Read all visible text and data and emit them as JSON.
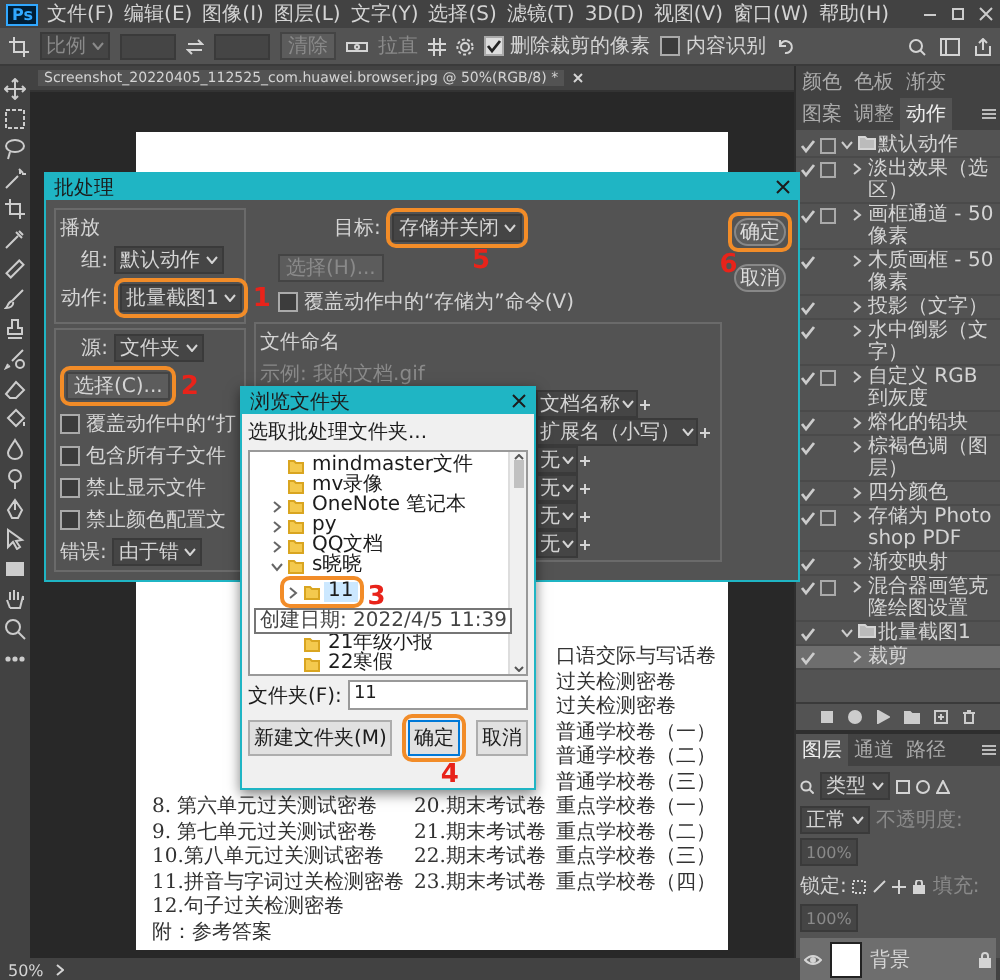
{
  "app_logo": "Ps",
  "menu_bar": {
    "items": [
      "文件(F)",
      "编辑(E)",
      "图像(I)",
      "图层(L)",
      "文字(Y)",
      "选择(S)",
      "滤镜(T)",
      "3D(D)",
      "视图(V)",
      "窗口(W)",
      "帮助(H)"
    ]
  },
  "options_bar": {
    "ratio": "比例",
    "clear": "清除",
    "straighten": "拉直",
    "checkboxes": [
      {
        "label": "删除裁剪的像素",
        "checked": true
      },
      {
        "label": "内容识别",
        "checked": false
      }
    ]
  },
  "document_tab": {
    "title": "Screenshot_20220405_112525_com.huawei.browser.jpg @ 50%(RGB/8) *"
  },
  "document": {
    "rows": [
      {
        "col_3": "口语交际与写话卷"
      },
      {
        "col_3": "过关检测密卷"
      },
      {
        "col_3": "过关检测密卷"
      },
      {
        "col_3": "普通学校卷（一）"
      },
      {
        "col_3": "普通学校卷（二）"
      },
      {
        "col_3": "普通学校卷（三）"
      },
      {
        "col_1": "8. 第六单元过关测试密卷",
        "col_2": "20.期末考试卷",
        "col_3": "重点学校卷（一）"
      },
      {
        "col_1": "9. 第七单元过关测试密卷",
        "col_2": "21.期末考试卷",
        "col_3": "重点学校卷（二）"
      },
      {
        "col_1": "10.第八单元过关测试密卷",
        "col_2": "22.期末考试卷",
        "col_3": "重点学校卷（三）"
      },
      {
        "col_1": "11.拼音与字词过关检测密卷",
        "col_2": "23.期末考试卷",
        "col_3": "重点学校卷（四）"
      },
      {
        "col_1": "12.句子过关检测密卷"
      }
    ],
    "appendix": "附：参考答案"
  },
  "batch_dialog": {
    "title": "批处理",
    "play": {
      "label": "播放",
      "set": {
        "label": "组:",
        "value": "默认动作"
      },
      "action": {
        "label": "动作:",
        "value": "批量截图1",
        "highlighted": true,
        "step": "1"
      }
    },
    "source": {
      "label": "源:",
      "value": "文件夹"
    },
    "choose": {
      "label": "选择(C)...",
      "highlighted": true,
      "step": "2"
    },
    "options": [
      {
        "label": "覆盖动作中的“打",
        "checked": false
      },
      {
        "label": "包含所有子文件",
        "checked": false
      },
      {
        "label": "禁止显示文件",
        "checked": false
      },
      {
        "label": "禁止颜色配置文",
        "checked": false
      }
    ],
    "errors": {
      "label": "错误:",
      "value": "由于错"
    },
    "destination": {
      "label": "目标:",
      "value": "存储并关闭",
      "highlighted": true,
      "step": "5"
    },
    "choose_destination": {
      "label": "选择(H)...",
      "disabled": true
    },
    "override_save": {
      "label": "覆盖动作中的“存储为”命令(V)",
      "checked": false
    },
    "file_naming": {
      "label": "文件命名",
      "example": "示例: 我的文档.gif",
      "fields": [
        "文档名称",
        "扩展名（小写）",
        "无",
        "无",
        "无",
        "无"
      ]
    },
    "buttons": [
      {
        "label": "确定",
        "highlighted": true,
        "step": "6"
      },
      {
        "label": "取消",
        "highlighted": false
      }
    ]
  },
  "browse_dialog": {
    "title": "浏览文件夹",
    "prompt": "选取批处理文件夹...",
    "tree": [
      {
        "label": "mindmaster文件",
        "kind": "leaf",
        "selected": false
      },
      {
        "label": "mv录像",
        "kind": "leaf",
        "selected": false
      },
      {
        "label": "OneNote 笔记本",
        "kind": "branch",
        "expanded": false,
        "selected": false
      },
      {
        "label": "py",
        "kind": "branch",
        "expanded": false,
        "selected": false
      },
      {
        "label": "QQ文档",
        "kind": "branch",
        "expanded": false,
        "selected": false
      },
      {
        "label": "s晓晓",
        "kind": "branch",
        "expanded": true,
        "selected": false,
        "children": [
          {
            "label": "11",
            "kind": "branch",
            "expanded": false,
            "selected": true,
            "highlighted": true,
            "step": "3"
          },
          {
            "label": "21年级小报",
            "kind": "leaf",
            "selected": false
          },
          {
            "label": "22寒假",
            "kind": "leaf",
            "selected": false
          }
        ]
      }
    ],
    "tooltip": "创建日期: 2022/4/5 11:39",
    "folder_field": {
      "label": "文件夹(F):",
      "value": "11"
    },
    "buttons": [
      {
        "label": "新建文件夹(M)",
        "highlighted": false,
        "default": false
      },
      {
        "label": "确定",
        "highlighted": true,
        "step": "4",
        "default": true
      },
      {
        "label": "取消",
        "highlighted": false,
        "default": false
      }
    ]
  },
  "actions_panel": {
    "tabs": [
      {
        "label": "颜色",
        "selected": false
      },
      {
        "label": "色板",
        "selected": false
      },
      {
        "label": "渐变",
        "selected": false
      },
      {
        "label": "图案",
        "selected": false
      },
      {
        "label": "调整",
        "selected": false
      },
      {
        "label": "动作",
        "selected": true
      }
    ],
    "sets": [
      {
        "label": "默认动作",
        "checked": true,
        "dialog": true,
        "expanded": true,
        "selected": false,
        "children": [
          {
            "label": "淡出效果（选区）",
            "checked": true,
            "dialog": true,
            "expanded": false,
            "selected": false
          },
          {
            "label": "画框通道 - 50 像素",
            "checked": true,
            "dialog": true,
            "expanded": false,
            "selected": false
          },
          {
            "label": "木质画框 - 50 像素",
            "checked": true,
            "dialog": false,
            "expanded": false,
            "selected": false
          },
          {
            "label": "投影（文字）",
            "checked": true,
            "dialog": false,
            "expanded": false,
            "selected": false
          },
          {
            "label": "水中倒影（文字）",
            "checked": true,
            "dialog": false,
            "expanded": false,
            "selected": false
          },
          {
            "label": "自定义 RGB 到灰度",
            "checked": true,
            "dialog": true,
            "expanded": false,
            "selected": false
          },
          {
            "label": "熔化的铅块",
            "checked": true,
            "dialog": false,
            "expanded": false,
            "selected": false
          },
          {
            "label": "棕褐色调（图层）",
            "checked": true,
            "dialog": false,
            "expanded": false,
            "selected": false
          },
          {
            "label": "四分颜色",
            "checked": true,
            "dialog": false,
            "expanded": false,
            "selected": false
          },
          {
            "label": "存储为 Photoshop PDF",
            "checked": true,
            "dialog": true,
            "expanded": false,
            "selected": false
          },
          {
            "label": "渐变映射",
            "checked": true,
            "dialog": false,
            "expanded": false,
            "selected": false
          },
          {
            "label": "混合器画笔克隆绘图设置",
            "checked": true,
            "dialog": true,
            "expanded": false,
            "selected": false
          }
        ]
      },
      {
        "label": "批量截图1",
        "checked": true,
        "dialog": false,
        "expanded": true,
        "selected": false,
        "children": [
          {
            "label": "裁剪",
            "checked": true,
            "dialog": false,
            "expanded": false,
            "selected": true
          }
        ]
      }
    ]
  },
  "layers_panel": {
    "tabs": [
      {
        "label": "图层",
        "selected": true
      },
      {
        "label": "通道",
        "selected": false
      },
      {
        "label": "路径",
        "selected": false
      }
    ],
    "filter": "类型",
    "blend_mode": "正常",
    "opacity_label": "不透明度:",
    "opacity": "100%",
    "lock_label": "锁定:",
    "fill_label": "填充:",
    "fill": "100%",
    "layers": [
      {
        "name": "背景",
        "visible": true,
        "locked": true,
        "selected": true
      }
    ]
  },
  "status_bar": {
    "zoom": "50%"
  }
}
